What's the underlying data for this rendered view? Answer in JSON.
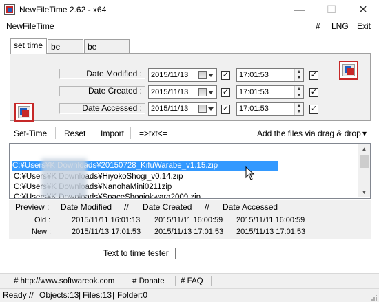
{
  "window": {
    "title": "NewFileTime 2.62 - x64",
    "minimize_glyph": "—",
    "maximize_glyph": "☐",
    "close_glyph": "✕"
  },
  "menu": {
    "app": "NewFileTime",
    "hash": "#",
    "lng": "LNG",
    "exit": "Exit"
  },
  "tabs": [
    {
      "label": "set time",
      "active": true
    },
    {
      "label": "be older",
      "active": false
    },
    {
      "label": "be younger",
      "active": false
    }
  ],
  "set_time": {
    "modified": {
      "label": "Date Modified :",
      "date": "2015/11/13",
      "time": "17:01:53",
      "checked": true
    },
    "created": {
      "label": "Date Created :",
      "date": "2015/11/13",
      "time": "17:01:53",
      "checked": true
    },
    "accessed": {
      "label": "Date Accessed :",
      "date": "2015/11/13",
      "time": "17:01:53",
      "checked": true
    }
  },
  "icons": {
    "app": "newfiletime-icon",
    "calendar": "calendar-clock-icon",
    "check": "✓",
    "spin_up": "▲",
    "spin_down": "▼"
  },
  "toolbar": {
    "set_time": "Set-Time",
    "reset": "Reset",
    "import": "Import",
    "txt": "=>txt<=",
    "add_files": "Add the files via drag & drop",
    "add_files_arrow": "▾"
  },
  "files": [
    {
      "path": "C:¥Users¥K          Downloads¥20150728_KifuWarabe_v1.15.zip",
      "selected": true
    },
    {
      "path": "C:¥Users¥K          Downloads¥HiyokoShogi_v0.14.zip",
      "selected": false
    },
    {
      "path": "C:¥Users¥K          Downloads¥NanohaMini0211zip",
      "selected": false
    },
    {
      "path": "C:¥Users¥K          Downloads¥SpaceShogiokwara2009.zip",
      "selected": false
    }
  ],
  "preview": {
    "label": "Preview :",
    "col_modified": "Date Modified",
    "sep1": "//",
    "col_created": "Date Created",
    "sep2": "//",
    "col_accessed": "Date Accessed",
    "old": {
      "label": "Old :",
      "modified": "2015/11/11 16:01:13",
      "created": "2015/11/11 16:00:59",
      "accessed": "2015/11/11 16:00:59"
    },
    "new": {
      "label": "New :",
      "modified": "2015/11/13 17:01:53",
      "created": "2015/11/13 17:01:53",
      "accessed": "2015/11/13 17:01:53"
    }
  },
  "tester": {
    "label": "Text to time tester",
    "value": ""
  },
  "links": {
    "website": "# http://www.softwareok.com",
    "donate": "# Donate",
    "faq": "# FAQ"
  },
  "status": {
    "ready": "Ready",
    "sep1": "//",
    "objects": "Objects:13",
    "sep2": "|",
    "files": "Files:13",
    "sep3": "|",
    "folder": "Folder:0"
  },
  "colors": {
    "selection": "#3399ff",
    "accent_red": "#c62828",
    "accent_blue": "#1e5fbf"
  }
}
